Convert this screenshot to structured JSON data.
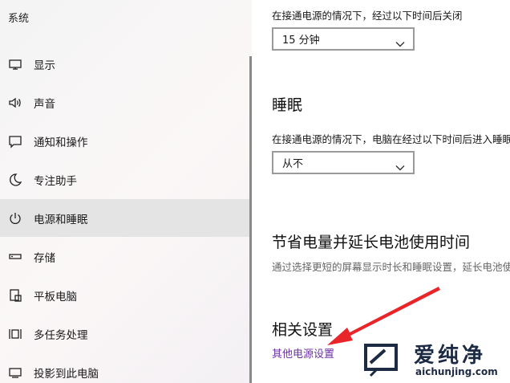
{
  "sidebar": {
    "title": "系统",
    "items": [
      {
        "label": "显示",
        "icon": "monitor-icon"
      },
      {
        "label": "声音",
        "icon": "speaker-icon"
      },
      {
        "label": "通知和操作",
        "icon": "notification-icon"
      },
      {
        "label": "专注助手",
        "icon": "moon-icon"
      },
      {
        "label": "电源和睡眠",
        "icon": "power-icon",
        "selected": true
      },
      {
        "label": "存储",
        "icon": "storage-icon"
      },
      {
        "label": "平板电脑",
        "icon": "tablet-icon"
      },
      {
        "label": "多任务处理",
        "icon": "multitask-icon"
      },
      {
        "label": "投影到此电脑",
        "icon": "project-icon"
      }
    ]
  },
  "screen": {
    "plugged_text": "在接通电源的情况下，经过以下时间后关闭",
    "value": "15 分钟"
  },
  "sleep": {
    "heading": "睡眠",
    "plugged_text": "在接通电源的情况下，电脑在经过以下时间后进入睡眠状态",
    "value": "从不"
  },
  "battery": {
    "heading": "节省电量并延长电池使用时间",
    "desc": "通过选择更短的屏幕显示时长和睡眠设置，延长电池使用时间。"
  },
  "related": {
    "heading": "相关设置",
    "link": "其他电源设置"
  },
  "watermark": {
    "cn": "爱纯净",
    "en": "aichunjing.com"
  },
  "colors": {
    "link": "#6b2fa3",
    "arrow": "#e8262a",
    "selected_bg": "#e4e4e4"
  }
}
